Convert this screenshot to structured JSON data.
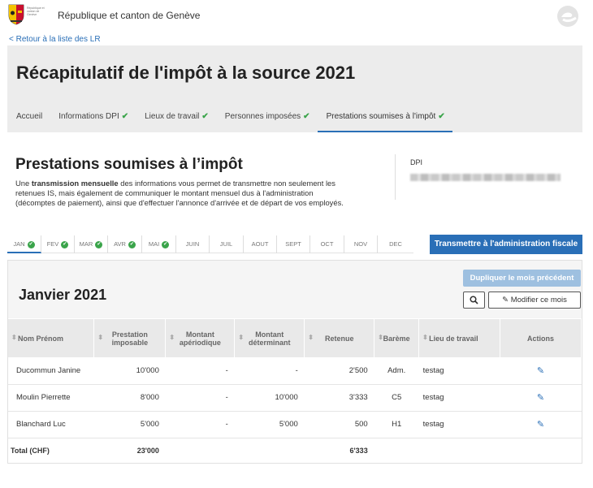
{
  "header": {
    "crest_text": "République et canton de Genève",
    "government_name": "République et canton de Genève",
    "back_link": "< Retour à la liste des LR",
    "page_title": "Récapitulatif de l'impôt à la source 2021"
  },
  "tabs": [
    {
      "label": "Accueil",
      "checked": false
    },
    {
      "label": "Informations DPI",
      "checked": true
    },
    {
      "label": "Lieux de travail",
      "checked": true
    },
    {
      "label": "Personnes imposées",
      "checked": true
    },
    {
      "label": "Prestations soumises à l'impôt",
      "checked": true,
      "active": true
    }
  ],
  "section": {
    "title": "Prestations soumises à l’impôt",
    "desc_prefix": "Une ",
    "desc_bold": "transmission mensuelle",
    "desc_rest": " des informations vous permet de transmettre non seulement les retenues IS, mais également de communiquer le montant mensuel dus à l'administration (décomptes de paiement), ainsi que d'effectuer l'annonce d'arrivée et de départ de vos employés.",
    "dpi_label": "DPI"
  },
  "months": [
    {
      "label": "JAN",
      "done": true
    },
    {
      "label": "FEV",
      "done": true
    },
    {
      "label": "MAR",
      "done": true
    },
    {
      "label": "AVR",
      "done": true
    },
    {
      "label": "MAI",
      "done": true
    },
    {
      "label": "JUIN",
      "done": false
    },
    {
      "label": "JUIL",
      "done": false
    },
    {
      "label": "AOUT",
      "done": false
    },
    {
      "label": "SEPT",
      "done": false
    },
    {
      "label": "OCT",
      "done": false
    },
    {
      "label": "NOV",
      "done": false
    },
    {
      "label": "DEC",
      "done": false
    }
  ],
  "actions": {
    "transmit": "Transmettre à l'administration fiscale",
    "duplicate": "Dupliquer le mois précédent",
    "modify": "Modifier ce mois"
  },
  "panel": {
    "month_title": "Janvier 2021"
  },
  "table": {
    "headers": [
      "Nom Prénom",
      "Prestation imposable",
      "Montant apériodique",
      "Montant déterminant",
      "Retenue",
      "Barème",
      "Lieu de travail",
      "Actions"
    ],
    "rows": [
      [
        "Ducommun Janine",
        "10'000",
        "-",
        "-",
        "2'500",
        "Adm.",
        "testag"
      ],
      [
        "Moulin Pierrette",
        "8'000",
        "-",
        "10'000",
        "3'333",
        "C5",
        "testag"
      ],
      [
        "Blanchard Luc",
        "5'000",
        "-",
        "5'000",
        "500",
        "H1",
        "testag"
      ]
    ],
    "total": {
      "label": "Total (CHF)",
      "prestation": "23'000",
      "retenue": "6'333"
    }
  },
  "colors": {
    "accent": "#2a6fb7",
    "check": "#3aa44a",
    "header_bg": "#ececec"
  }
}
